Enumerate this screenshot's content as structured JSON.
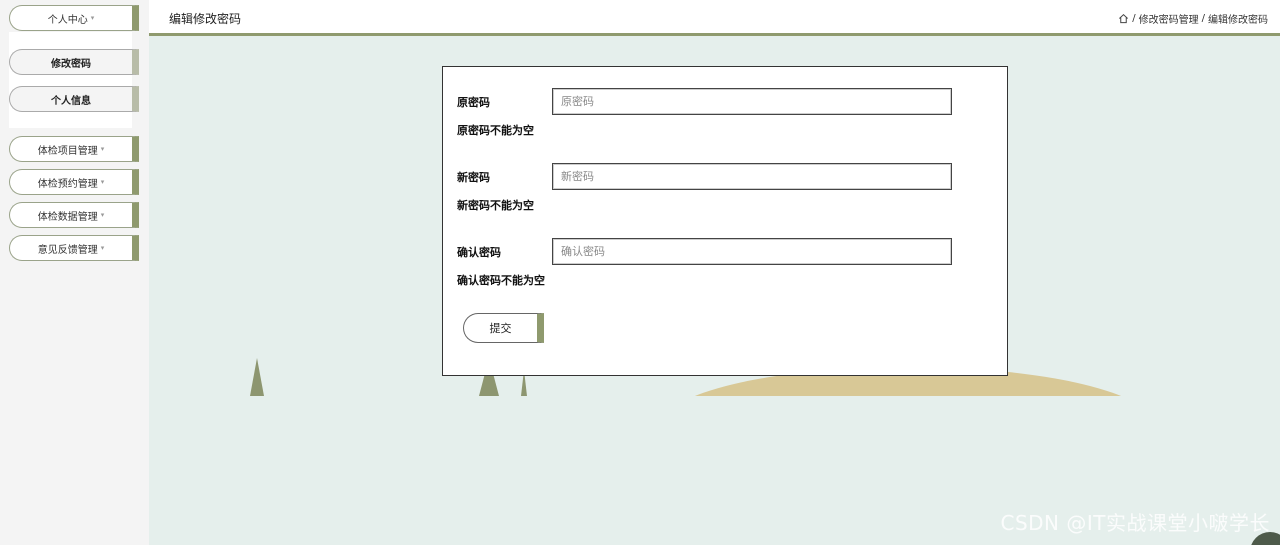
{
  "sidebar": {
    "items": [
      {
        "label": "个人中心",
        "caret": "▾"
      },
      {
        "label": "体检项目管理",
        "caret": "▾"
      },
      {
        "label": "体检预约管理",
        "caret": "▾"
      },
      {
        "label": "体检数据管理",
        "caret": "▾"
      },
      {
        "label": "意见反馈管理",
        "caret": "▾"
      }
    ],
    "submenu": [
      {
        "label": "修改密码"
      },
      {
        "label": "个人信息"
      }
    ]
  },
  "header": {
    "title": "编辑修改密码",
    "breadcrumb": {
      "home_icon": "home-icon",
      "separator": "/",
      "level1": "修改密码管理",
      "level2": "编辑修改密码"
    }
  },
  "form": {
    "old_password": {
      "label": "原密码",
      "placeholder": "原密码",
      "error": "原密码不能为空"
    },
    "new_password": {
      "label": "新密码",
      "placeholder": "新密码",
      "error": "新密码不能为空"
    },
    "confirm_password": {
      "label": "确认密码",
      "placeholder": "确认密码",
      "error": "确认密码不能为空"
    },
    "submit_label": "提交"
  },
  "watermark": "CSDN @IT实战课堂小啵学长",
  "colors": {
    "accent": "#8f9a6e",
    "background": "#e5efec",
    "hill": "#d8c896"
  }
}
